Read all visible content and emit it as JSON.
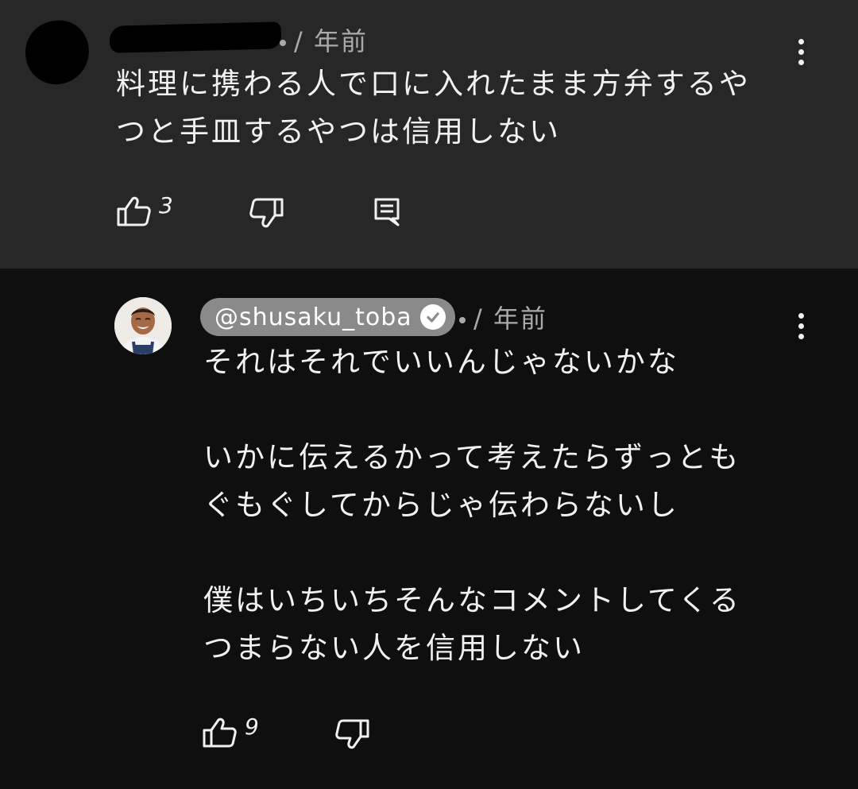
{
  "top_comment": {
    "time": "/ 年前",
    "text": "料理に携わる人で口に入れたまま方弁するや\nつと手皿するやつは信用しない",
    "like_count": "3",
    "icons": {
      "like": "thumbs-up-icon",
      "dislike": "thumbs-down-icon",
      "reply": "reply-icon",
      "menu": "more-vert-icon"
    }
  },
  "reply_comment": {
    "author": "@shusaku_toba",
    "verified_icon": "verified-check-icon",
    "time": "/ 年前",
    "text": "それはそれでいいんじゃないかな\n\nいかに伝えるかって考えたらずっとも\nぐもぐしてからじゃ伝わらないし\n\n僕はいちいちそんなコメントしてくる\nつまらない人を信用しない",
    "like_count": "9",
    "icons": {
      "like": "thumbs-up-icon",
      "dislike": "thumbs-down-icon",
      "menu": "more-vert-icon"
    }
  },
  "colors": {
    "top_background": "#272727",
    "reply_background": "#0f0f0f",
    "text": "#f1f1f1",
    "secondary_text": "#aaaaaa",
    "author_chip": "#8a8a8a"
  }
}
